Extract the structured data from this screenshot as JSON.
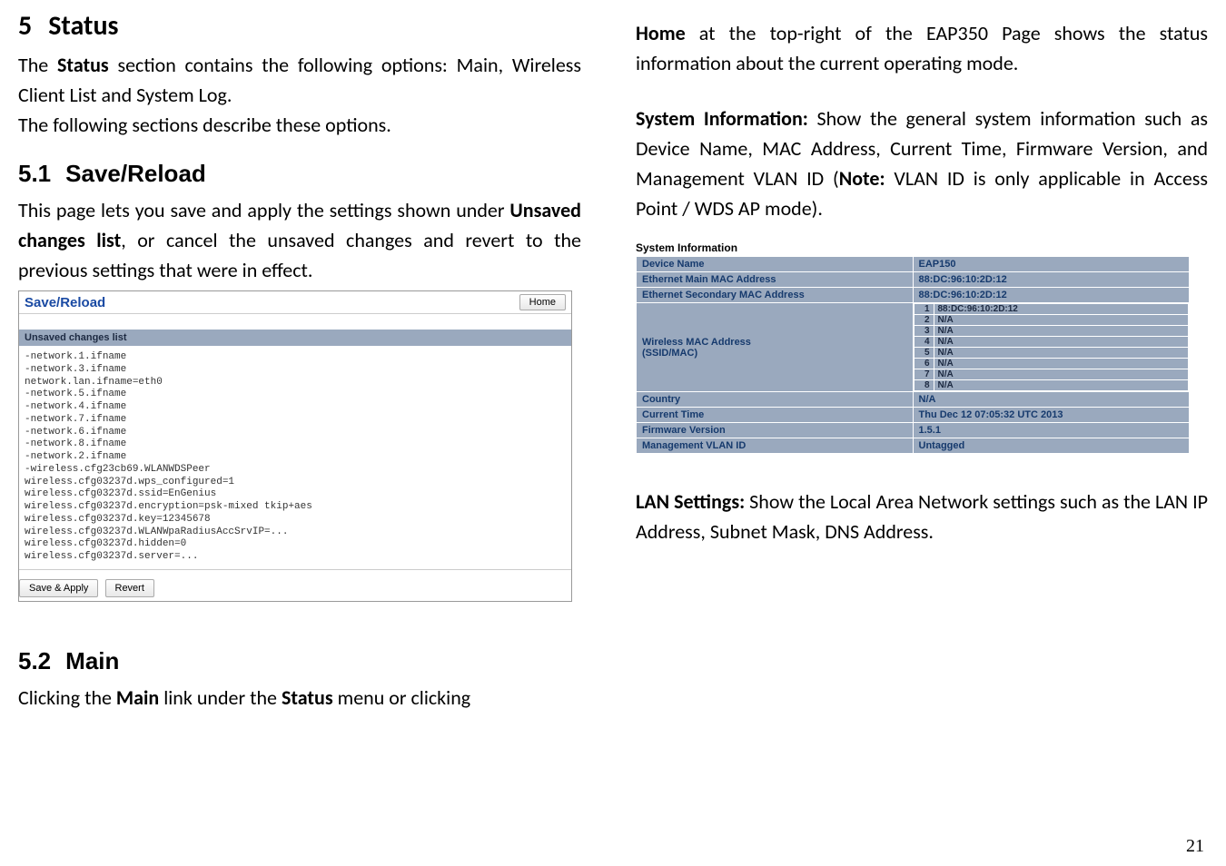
{
  "page_number": "21",
  "left": {
    "h1_num": "5",
    "h1_title": "Status",
    "p1_a": "The ",
    "p1_b": "Status",
    "p1_c": " section contains the following options: Main, Wireless Client List and System Log.",
    "p2": "The following sections describe these options.",
    "h2a_num": "5.1",
    "h2a_title": "Save/Reload",
    "p3_a": "This page lets you save and apply the settings shown under ",
    "p3_b": "Unsaved changes list",
    "p3_c": ", or cancel the unsaved changes and revert to the previous settings that were in effect.",
    "ss1": {
      "title": "Save/Reload",
      "home": "Home",
      "bar": "Unsaved changes list",
      "pre": "-network.1.ifname\n-network.3.ifname\nnetwork.lan.ifname=eth0\n-network.5.ifname\n-network.4.ifname\n-network.7.ifname\n-network.6.ifname\n-network.8.ifname\n-network.2.ifname\n-wireless.cfg23cb69.WLANWDSPeer\nwireless.cfg03237d.wps_configured=1\nwireless.cfg03237d.ssid=EnGenius\nwireless.cfg03237d.encryption=psk-mixed tkip+aes\nwireless.cfg03237d.key=12345678\nwireless.cfg03237d.WLANWpaRadiusAccSrvIP=...\nwireless.cfg03237d.hidden=0\nwireless.cfg03237d.server=...",
      "save_apply": "Save & Apply",
      "revert": "Revert"
    },
    "h2b_num": "5.2",
    "h2b_title": "Main",
    "p4_a": "Clicking the ",
    "p4_b": "Main",
    "p4_c": " link under the ",
    "p4_d": "Status",
    "p4_e": " menu or clicking"
  },
  "right": {
    "p1_a": "Home",
    "p1_b": " at the top-right of the EAP350 Page shows the status information about the current operating mode.",
    "p2_a": "System Information:",
    "p2_b": " Show the  general system information such as Device Name, MAC Address, Current Time, Firmware Version, and Management VLAN ID (",
    "p2_c": "Note:",
    "p2_d": " VLAN ID is only applicable in Access Point / WDS AP mode).",
    "ss2": {
      "title": "System Information",
      "rows": [
        {
          "label": "Device Name",
          "value": "EAP150"
        },
        {
          "label": "Ethernet Main MAC Address",
          "value": "88:DC:96:10:2D:12"
        },
        {
          "label": "Ethernet Secondary MAC Address",
          "value": "88:DC:96:10:2D:12"
        }
      ],
      "wireless_label": "Wireless MAC Address\n(SSID/MAC)",
      "wireless": [
        {
          "idx": "1",
          "val": "88:DC:96:10:2D:12"
        },
        {
          "idx": "2",
          "val": "N/A"
        },
        {
          "idx": "3",
          "val": "N/A"
        },
        {
          "idx": "4",
          "val": "N/A"
        },
        {
          "idx": "5",
          "val": "N/A"
        },
        {
          "idx": "6",
          "val": "N/A"
        },
        {
          "idx": "7",
          "val": "N/A"
        },
        {
          "idx": "8",
          "val": "N/A"
        }
      ],
      "rows2": [
        {
          "label": "Country",
          "value": "N/A"
        },
        {
          "label": "Current Time",
          "value": "Thu Dec 12 07:05:32 UTC 2013"
        },
        {
          "label": "Firmware Version",
          "value": "1.5.1"
        },
        {
          "label": "Management VLAN ID",
          "value": "Untagged"
        }
      ]
    },
    "p3_a": "LAN Settings:",
    "p3_b": " Show the Local Area Network settings such as the LAN IP Address, Subnet Mask, DNS Address."
  }
}
